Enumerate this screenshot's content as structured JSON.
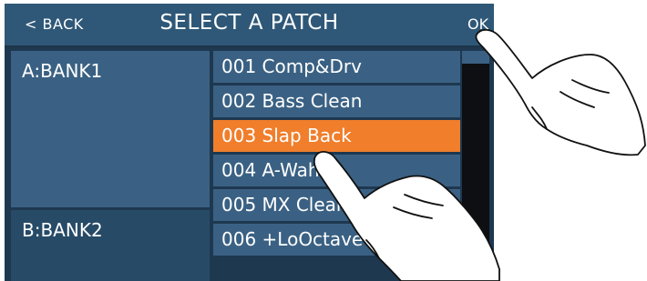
{
  "header": {
    "back_label": "< BACK",
    "title": "SELECT A PATCH",
    "ok_label": "OK"
  },
  "banks": [
    {
      "label": "A:BANK1",
      "selected": true
    },
    {
      "label": "B:BANK2",
      "selected": false
    }
  ],
  "patches": [
    {
      "label": "001 Comp&Drv"
    },
    {
      "label": "002 Bass Clean"
    },
    {
      "label": "003 Slap Back",
      "selected": true
    },
    {
      "label": "004 A-Wah"
    },
    {
      "label": "005 MX Clean"
    },
    {
      "label": "006 +LoOctave"
    }
  ],
  "colors": {
    "header": "#2f5878",
    "item": "#3a6183",
    "selected": "#f07e2b",
    "background": "#1e3850"
  },
  "icons": [
    "tapping-hand-icon",
    "tapping-hand-icon"
  ]
}
